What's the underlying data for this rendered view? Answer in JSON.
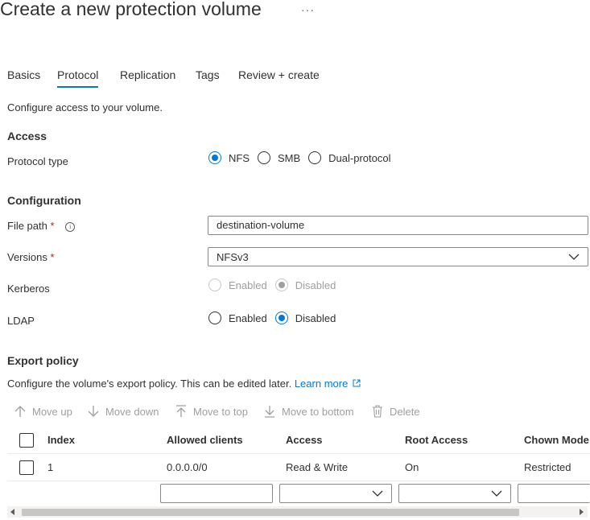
{
  "page": {
    "title": "Create a new protection volume",
    "more_label": "···"
  },
  "tabs": [
    {
      "label": "Basics"
    },
    {
      "label": "Protocol"
    },
    {
      "label": "Replication"
    },
    {
      "label": "Tags"
    },
    {
      "label": "Review + create"
    }
  ],
  "intro": "Configure access to your volume.",
  "access": {
    "heading": "Access",
    "protocol_type": {
      "label": "Protocol type",
      "options": [
        "NFS",
        "SMB",
        "Dual-protocol"
      ],
      "selected": "NFS"
    }
  },
  "configuration": {
    "heading": "Configuration",
    "file_path": {
      "label": "File path",
      "required": "*",
      "info": "i",
      "value": "destination-volume"
    },
    "versions": {
      "label": "Versions",
      "required": "*",
      "value": "NFSv3"
    },
    "kerberos": {
      "label": "Kerberos",
      "options": [
        "Enabled",
        "Disabled"
      ],
      "selected": "Disabled"
    },
    "ldap": {
      "label": "LDAP",
      "options": [
        "Enabled",
        "Disabled"
      ],
      "selected": "Disabled"
    }
  },
  "export_policy": {
    "heading": "Export policy",
    "description": "Configure the volume's export policy. This can be edited later.",
    "learn_more": "Learn more",
    "toolbar": {
      "move_up": "Move up",
      "move_down": "Move down",
      "move_to_top": "Move to top",
      "move_to_bottom": "Move to bottom",
      "delete": "Delete"
    },
    "columns": [
      "Index",
      "Allowed clients",
      "Access",
      "Root Access",
      "Chown Mode"
    ],
    "rows": [
      {
        "index": "1",
        "allowed_clients": "0.0.0.0/0",
        "access": "Read & Write",
        "root_access": "On",
        "chown_mode": "Restricted"
      }
    ]
  },
  "colors": {
    "accent": "#0078d4",
    "required": "#a4262c",
    "disabled": "#a19f9d"
  },
  "icons": [
    "more-icon",
    "info-icon",
    "chevron-down-icon",
    "external-link-icon",
    "arrow-up-icon",
    "arrow-down-icon",
    "arrow-to-top-icon",
    "arrow-to-bottom-icon",
    "trash-icon"
  ]
}
